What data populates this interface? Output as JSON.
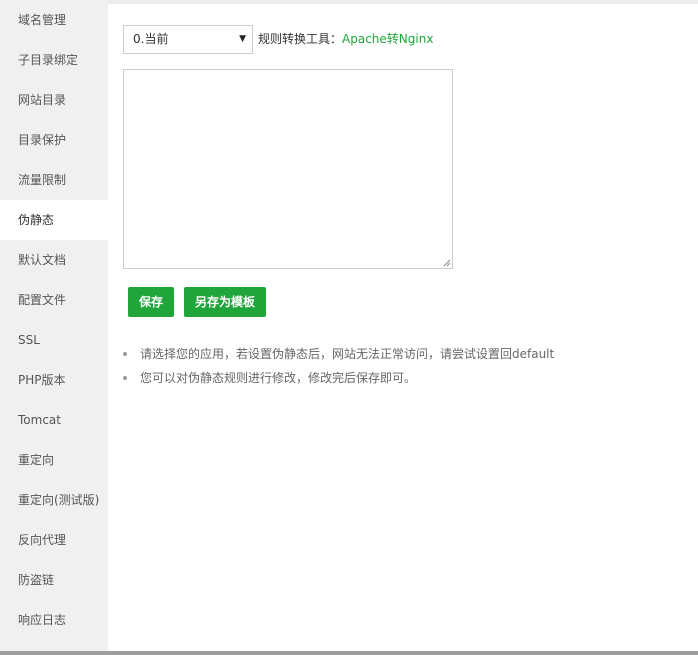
{
  "sidebar": {
    "items": [
      {
        "label": "域名管理"
      },
      {
        "label": "子目录绑定"
      },
      {
        "label": "网站目录"
      },
      {
        "label": "目录保护"
      },
      {
        "label": "流量限制"
      },
      {
        "label": "伪静态",
        "active": true
      },
      {
        "label": "默认文档"
      },
      {
        "label": "配置文件"
      },
      {
        "label": "SSL"
      },
      {
        "label": "PHP版本"
      },
      {
        "label": "Tomcat"
      },
      {
        "label": "重定向"
      },
      {
        "label": "重定向(测试版)"
      },
      {
        "label": "反向代理"
      },
      {
        "label": "防盗链"
      },
      {
        "label": "响应日志"
      }
    ]
  },
  "rewrite": {
    "template_select": {
      "value": "0.当前"
    },
    "tool_label": "规则转换工具：",
    "tool_link": "Apache转Nginx",
    "rules_text": "",
    "save_label": "保存",
    "save_as_template_label": "另存为模板",
    "tips": [
      "请选择您的应用，若设置伪静态后，网站无法正常访问，请尝试设置回default",
      "您可以对伪静态规则进行修改，修改完后保存即可。"
    ]
  },
  "colors": {
    "accent": "#20a53a",
    "sidebar_bg": "#f0f0f0"
  }
}
